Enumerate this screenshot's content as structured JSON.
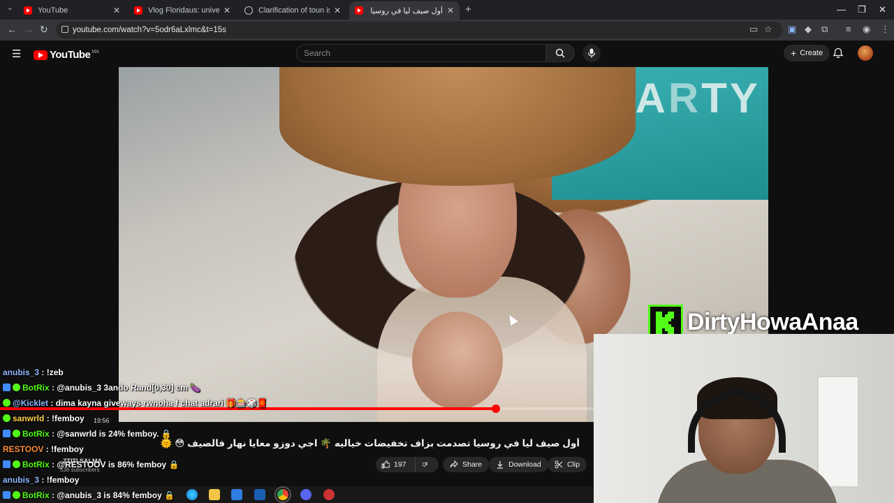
{
  "browser": {
    "tabs": [
      {
        "title": "YouTube",
        "favicon": "youtube-icon",
        "active": false
      },
      {
        "title": "Vlog Floridaus: universal studio",
        "favicon": "youtube-icon",
        "active": false
      },
      {
        "title": "Clarification of toun isabel",
        "favicon": "globe-icon",
        "active": false
      },
      {
        "title": "أول صيف ليا في روسيا تعجز",
        "favicon": "youtube-icon",
        "active": true
      }
    ],
    "url": "youtube.com/watch?v=5odr6aLxlmc&t=15s"
  },
  "youtube": {
    "logo_text": "YouTube",
    "country_code": "MA",
    "search_placeholder": "Search",
    "create_label": "Create",
    "video": {
      "title": "أول صيف ليا في روسيا تصدمت بزاف تخفيضات خياليه 🌴 اجي دوزو معايا نهار فالصيف 😳 🌞 summer vlog :pool day",
      "channel": "ZTITI SALMA",
      "subscribers": "536 subscribers",
      "progress": 0.835,
      "time_overlay": "19:56"
    },
    "actions": {
      "likes": "197",
      "share_label": "Share",
      "download_label": "Download",
      "clip_label": "Clip"
    }
  },
  "stream": {
    "streamer_name": "DirtyHowaAnaa",
    "platform_color": "#53fc18",
    "chat": [
      {
        "user": "anubis_3",
        "message": "!zeb",
        "color": "blue"
      },
      {
        "user": "BotRix",
        "message": "@anubis_3 3ando Rand[0,30] cm 🍆",
        "color": "green"
      },
      {
        "user": "@Kicklet",
        "message": "dima kayna giveways rwnoha f chat adrari 🎁🎰🎲🧧",
        "color": "blue"
      },
      {
        "user": "sanwrld",
        "message": "!femboy",
        "color": "yellow"
      },
      {
        "user": "BotRix",
        "message": "@sanwrld is 24% femboy. 🔒",
        "color": "green"
      },
      {
        "user": "RESTOOV",
        "message": "!femboy",
        "color": "orange"
      },
      {
        "user": "BotRix",
        "message": "@RESTOOV is 86% femboy 🔒",
        "color": "green"
      },
      {
        "user": "anubis_3",
        "message": "!femboy",
        "color": "blue"
      },
      {
        "user": "BotRix",
        "message": "@anubis_3 is 84% femboy 🔒",
        "color": "green"
      }
    ]
  }
}
